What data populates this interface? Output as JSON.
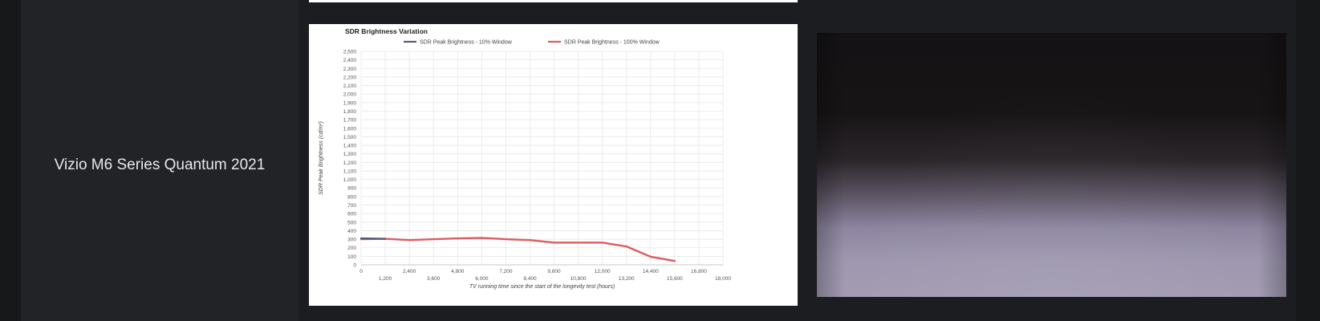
{
  "row": {
    "tv_name": "Vizio M6 Series Quantum 2021"
  },
  "colors": {
    "series_10pct": "#5a5a78",
    "series_100pct": "#e05a60",
    "grid": "#e6e6e6",
    "page_bg": "#191a1c",
    "cell_bg": "#222326"
  },
  "photo": {
    "icon": "tv-screen-uniformity-photo"
  },
  "chart_data": {
    "type": "line",
    "title": "SDR Brightness Variation",
    "xlabel": "TV running time since the start of the longevity test (hours)",
    "ylabel": "SDR Peak Brightness (cd/m²)",
    "xlim": [
      0,
      18000
    ],
    "ylim": [
      0,
      2500
    ],
    "x_ticks": [
      0,
      1200,
      2400,
      3600,
      4800,
      6000,
      7200,
      8400,
      9600,
      10800,
      12000,
      13200,
      14400,
      15600,
      16800,
      18000
    ],
    "x_tick_labels": [
      "0",
      "1,200",
      "2,400",
      "3,600",
      "4,800",
      "6,000",
      "7,200",
      "8,400",
      "9,600",
      "10,800",
      "12,000",
      "13,200",
      "14,400",
      "15,600",
      "16,800",
      "18,000"
    ],
    "y_ticks": [
      0,
      100,
      200,
      300,
      400,
      500,
      600,
      700,
      800,
      900,
      1000,
      1100,
      1200,
      1300,
      1400,
      1500,
      1600,
      1700,
      1800,
      1900,
      2000,
      2100,
      2200,
      2300,
      2400,
      2500
    ],
    "y_tick_labels": [
      "0",
      "100",
      "200",
      "300",
      "400",
      "500",
      "600",
      "700",
      "800",
      "900",
      "1,000",
      "1,100",
      "1,200",
      "1,300",
      "1,400",
      "1,500",
      "1,600",
      "1,700",
      "1,800",
      "1,900",
      "2,000",
      "2,100",
      "2,200",
      "2,300",
      "2,400",
      "2,500"
    ],
    "grid": true,
    "legend_position": "top",
    "series": [
      {
        "name": "SDR Peak Brightness - 10% Window",
        "color": "#5a5a78",
        "x": [
          0,
          1200
        ],
        "y": [
          310,
          305
        ]
      },
      {
        "name": "SDR Peak Brightness - 100% Window",
        "color": "#e05a60",
        "x": [
          0,
          1200,
          2400,
          3600,
          4800,
          6000,
          7200,
          8400,
          9600,
          10800,
          12000,
          13200,
          14400,
          15600
        ],
        "y": [
          300,
          305,
          290,
          300,
          310,
          315,
          300,
          290,
          260,
          260,
          260,
          215,
          95,
          45
        ]
      }
    ]
  }
}
